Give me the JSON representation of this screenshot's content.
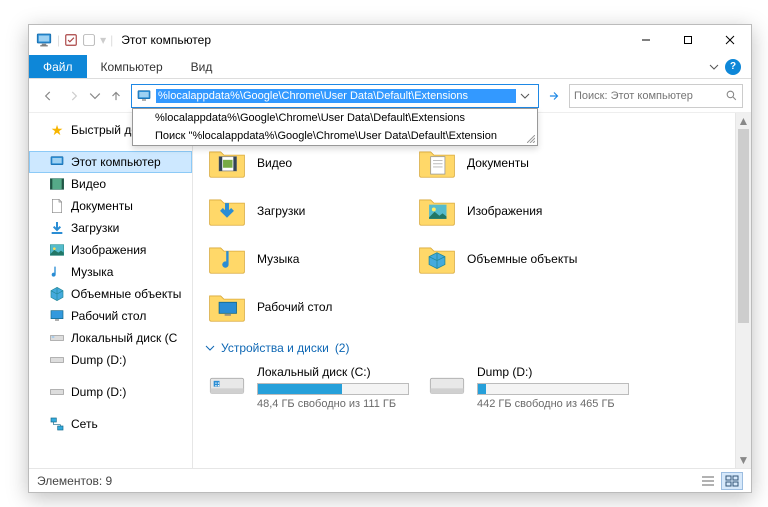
{
  "title": "Этот компьютер",
  "win": {
    "min": "—",
    "max": "▢",
    "close": "✕"
  },
  "ribbon": {
    "file": "Файл",
    "computer": "Компьютер",
    "view": "Вид"
  },
  "address": {
    "path": "%localappdata%\\Google\\Chrome\\User Data\\Default\\Extensions",
    "suggest1": "%localappdata%\\Google\\Chrome\\User Data\\Default\\Extensions",
    "suggest2": "Поиск \"%localappdata%\\Google\\Chrome\\User Data\\Default\\Extension"
  },
  "search": {
    "placeholder": "Поиск: Этот компьютер"
  },
  "sidebar": {
    "quick": "Быстрый доступ",
    "thispc": "Этот компьютер",
    "items": {
      "video": "Видео",
      "docs": "Документы",
      "downloads": "Загрузки",
      "images": "Изображения",
      "music": "Музыка",
      "objects": "Объемные объекты",
      "desktop": "Рабочий стол",
      "localc": "Локальный диск (C",
      "dump1": "Dump (D:)",
      "dump2": "Dump (D:)"
    },
    "network": "Сеть"
  },
  "folders": {
    "video": "Видео",
    "downloads": "Загрузки",
    "music": "Музыка",
    "desktop": "Рабочий стол",
    "docs": "Документы",
    "images": "Изображения",
    "objects": "Объемные объекты"
  },
  "section": {
    "label": "Устройства и диски",
    "count": "(2)"
  },
  "drives": {
    "c": {
      "name": "Локальный диск (C:)",
      "stat": "48,4 ГБ свободно из 111 ГБ",
      "fill": 56
    },
    "d": {
      "name": "Dump (D:)",
      "stat": "442 ГБ свободно из 465 ГБ",
      "fill": 5
    }
  },
  "status": {
    "items": "Элементов: 9"
  }
}
